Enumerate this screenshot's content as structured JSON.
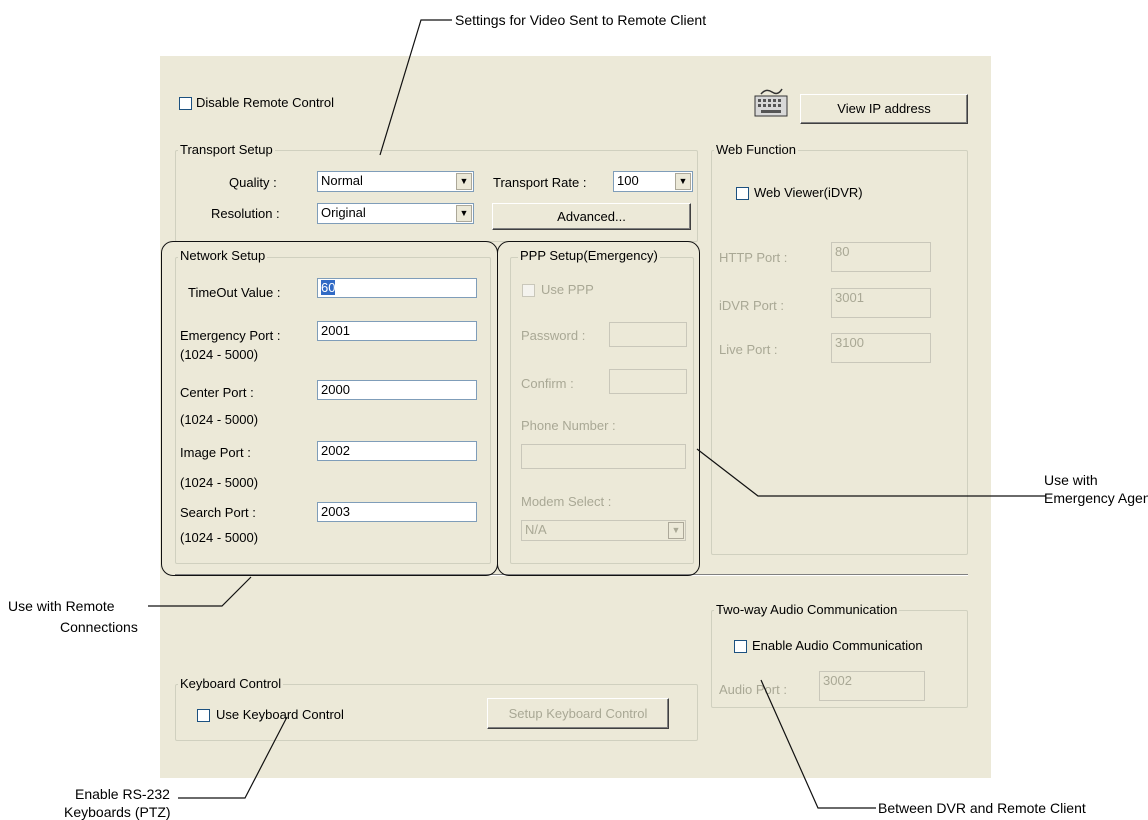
{
  "dialog": {
    "disable_remote_control": "Disable Remote Control",
    "view_ip_button": "View IP address",
    "transport": {
      "group_title": "Transport Setup",
      "quality_label": "Quality :",
      "quality_value": "Normal",
      "resolution_label": "Resolution :",
      "resolution_value": "Original",
      "rate_label": "Transport Rate :",
      "rate_value": "100",
      "advanced_button": "Advanced..."
    },
    "network": {
      "group_title": "Network Setup",
      "timeout_label": "TimeOut Value :",
      "timeout_value": "60",
      "emergency_label": "Emergency Port :",
      "emergency_range": "(1024 - 5000)",
      "emergency_value": "2001",
      "center_label": "Center Port :",
      "center_range": "(1024 - 5000)",
      "center_value": "2000",
      "image_label": "Image Port :",
      "image_range": "(1024 - 5000)",
      "image_value": "2002",
      "search_label": "Search Port :",
      "search_range": "(1024 - 5000)",
      "search_value": "2003"
    },
    "ppp": {
      "group_title": "PPP Setup(Emergency)",
      "use_ppp": "Use PPP",
      "password_label": "Password :",
      "confirm_label": "Confirm :",
      "phone_label": "Phone Number :",
      "modem_label": "Modem Select :",
      "modem_value": "N/A"
    },
    "web": {
      "group_title": "Web Function",
      "web_viewer": "Web Viewer(iDVR)",
      "http_label": "HTTP Port :",
      "http_value": "80",
      "idvr_label": "iDVR Port :",
      "idvr_value": "3001",
      "live_label": "Live Port :",
      "live_value": "3100"
    },
    "audio": {
      "group_title": "Two-way Audio Communication",
      "enable": "Enable Audio Communication",
      "port_label": "Audio Port :",
      "port_value": "3002"
    },
    "keyboard": {
      "group_title": "Keyboard Control",
      "use": "Use Keyboard Control",
      "setup_button": "Setup Keyboard Control"
    }
  },
  "annotations": {
    "video_settings": "Settings for Video Sent to Remote Client",
    "emergency_line1": "Use with",
    "emergency_line2": "Emergency Agent",
    "remote_line1": "Use with Remote",
    "remote_line2": "Connections",
    "rs232_line1": "Enable RS-232",
    "rs232_line2": "Keyboards (PTZ)",
    "audio_between": "Between DVR and Remote Client"
  }
}
